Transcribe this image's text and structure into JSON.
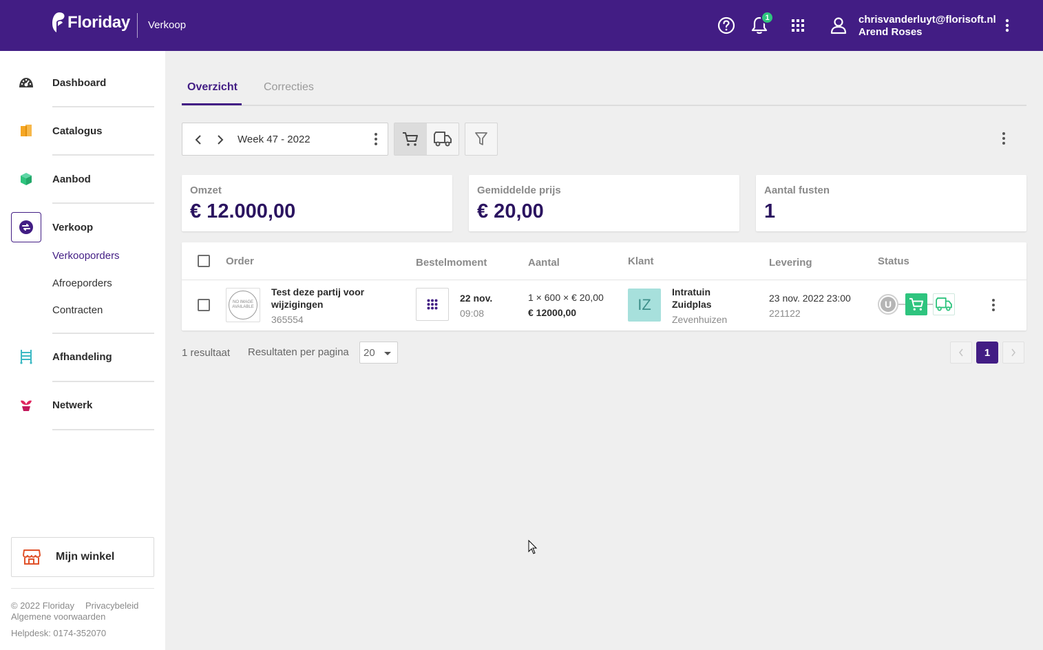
{
  "header": {
    "brand": "Floriday",
    "app_title": "Verkoop",
    "notification_count": "1",
    "user_email": "chrisvanderluyt@florisoft.nl",
    "user_company": "Arend Roses",
    "icons": [
      "help-icon",
      "bell-icon",
      "apps-grid-icon",
      "user-icon",
      "more-vertical-icon"
    ],
    "colors": {
      "brand": "#421d84",
      "accent_green": "#2ec47e"
    }
  },
  "sidebar": {
    "items": [
      {
        "label": "Dashboard",
        "icon": "dashboard-gauge-icon"
      },
      {
        "label": "Catalogus",
        "icon": "catalog-icon"
      },
      {
        "label": "Aanbod",
        "icon": "box-icon"
      },
      {
        "label": "Verkoop",
        "icon": "sale-exchange-icon"
      },
      {
        "label": "Afhandeling",
        "icon": "trolley-icon"
      },
      {
        "label": "Netwerk",
        "icon": "plant-icon"
      }
    ],
    "subitems": [
      "Verkooporders",
      "Afroeporders",
      "Contracten"
    ],
    "shop_button": "Mijn winkel",
    "footer": {
      "copyright": "© 2022 Floriday",
      "privacy": "Privacybeleid",
      "terms": "Algemene voorwaarden",
      "helpdesk": "Helpdesk: 0174-352070"
    }
  },
  "tabs": [
    "Overzicht",
    "Correcties"
  ],
  "toolbar": {
    "week": "Week 47 - 2022"
  },
  "stats": [
    {
      "label": "Omzet",
      "value": "€ 12.000,00"
    },
    {
      "label": "Gemiddelde prijs",
      "value": "€ 20,00"
    },
    {
      "label": "Aantal fusten",
      "value": "1"
    }
  ],
  "table": {
    "headers": [
      "Order",
      "Bestelmoment",
      "Aantal",
      "Klant",
      "Levering",
      "Status"
    ],
    "rows": [
      {
        "image_text": "NO IMAGE AVAILABLE",
        "title_line1": "Test deze partij voor",
        "title_line2": "wijzigingen",
        "order_id": "365554",
        "order_date": "22 nov.",
        "order_time": "09:08",
        "quantity": "1 × 600 × € 20,00",
        "total": "€ 12000,00",
        "customer_initials": "IZ",
        "customer_line1": "Intratuin",
        "customer_line2": "Zuidplas",
        "customer_city": "Zevenhuizen",
        "delivery_date": "23 nov. 2022 23:00",
        "delivery_code": "221122",
        "status_initial": "U"
      }
    ]
  },
  "pagination": {
    "results": "1 resultaat",
    "per_page_label": "Resultaten per pagina",
    "per_page_value": "20",
    "current_page": "1"
  }
}
